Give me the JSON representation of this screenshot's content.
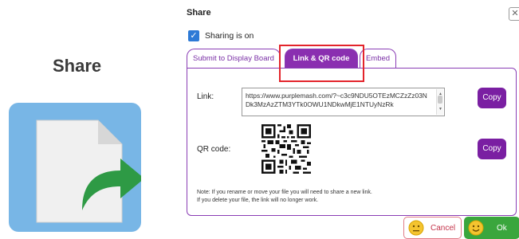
{
  "left": {
    "title": "Share",
    "tile_icon": "share-file-icon"
  },
  "dialog": {
    "title": "Share",
    "close_icon": "close-icon",
    "sharing": {
      "label": "Sharing is on",
      "checked": true
    },
    "tabs": [
      {
        "label": "Submit to Display Board",
        "active": false
      },
      {
        "label": "Link & QR code",
        "active": true
      },
      {
        "label": "Embed",
        "active": false
      }
    ],
    "link_label": "Link:",
    "link_value": "https://www.purplemash.com/?~c3c9NDU5OTEzMCZzZz03NDk3MzAzZTM3YTk0OWU1NDkwMjE1NTUyNzRk",
    "copy_link_label": "Copy",
    "qr_label": "QR code:",
    "copy_qr_label": "Copy",
    "note_line1": "Note: If you rename or move your file you will need to share a new link.",
    "note_line2": "If you delete your file, the link will no longer work.",
    "cancel_label": "Cancel",
    "ok_label": "Ok"
  },
  "colors": {
    "purple": "#8a2fb0",
    "highlight": "#e3242b",
    "ok_green": "#3aa63d",
    "tile_blue": "#78b6e6",
    "checkbox_blue": "#2d7ad6"
  }
}
